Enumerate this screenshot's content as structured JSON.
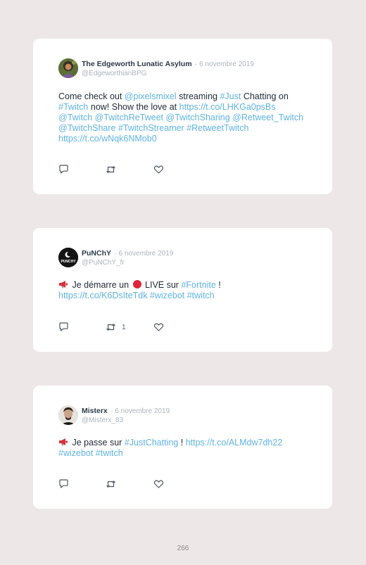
{
  "tweets": [
    {
      "author": "The Edgeworth Lunatic Asylum",
      "date": "· 6 novembre 2019",
      "handle": "@EdgeworthianBPG",
      "text": {
        "t1": "Come check out ",
        "l1": "@pixelsmixel",
        "t2": " streaming ",
        "l2": "#Just",
        "t3": " Chatting on ",
        "l3": "#Twitch",
        "t4": " now! Show the love at ",
        "l4": "https://t.co/LHKGa0psBs",
        "t5": "@Twitch @TwitchReTweet @TwitchSharing @Retweet_Twitch @TwitchShare #TwitchStreamer #RetweetTwitch https://t.co/wNqk6NMob0"
      },
      "retweets": "",
      "avatar_icon": "lunatic-asylum-avatar"
    },
    {
      "author": "PuNChY",
      "date": "· 6 novembre 2019",
      "handle": "@PuNChY_fr",
      "text": {
        "t1": " Je démarre un ",
        "t2": " LIVE sur ",
        "l1": "#Fortnite",
        "t3": " !",
        "l2": "https://t.co/K6DsIteTdk #wizebot #twitch"
      },
      "retweets": "1",
      "avatar_icon": "punchy-logo-avatar",
      "avatar_text": "PUNCHY"
    },
    {
      "author": "Misterx",
      "date": "· 6 novembre 2019",
      "handle": "@Misterx_83",
      "text": {
        "t1": " Je passe sur ",
        "l1": "#JustChatting",
        "t2": " ! ",
        "l2": "https://t.co/ALMdw7dh22",
        "l3": "#wizebot #twitch"
      },
      "retweets": "",
      "avatar_icon": "misterx-avatar"
    }
  ],
  "icons": {
    "reply": "reply-icon",
    "retweet": "retweet-icon",
    "like": "heart-icon",
    "megaphone": "megaphone-emoji",
    "red_circle": "red-circle-emoji"
  },
  "colors": {
    "background": "#ede8e7",
    "card": "#ffffff",
    "link": "#5fb3e6",
    "text": "#1f2a35",
    "muted": "#aab4bd"
  },
  "footer": {
    "page_number": "266"
  }
}
